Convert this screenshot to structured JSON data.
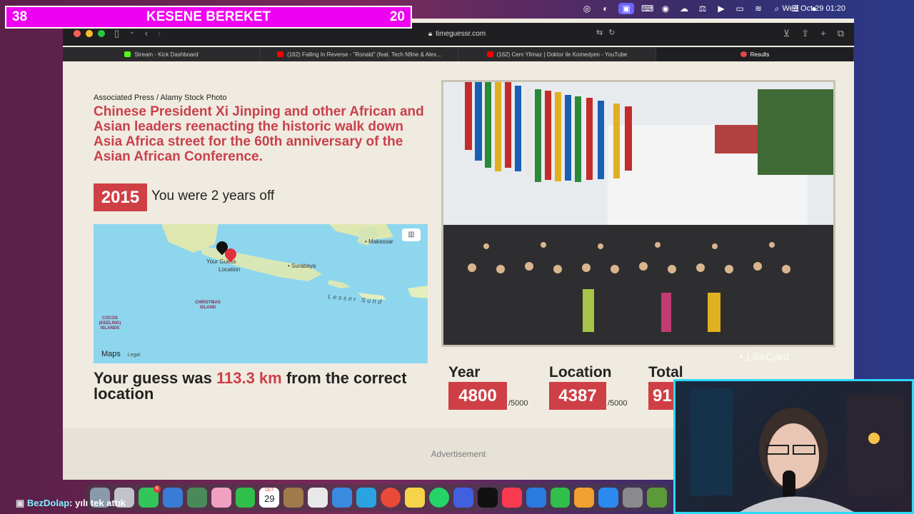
{
  "menubar": {
    "clock": "Wed Oct 29  01:20"
  },
  "overlay": {
    "left_number": "38",
    "title": "KESENE BEREKET",
    "right_number": "20"
  },
  "browser": {
    "url": "timeguessr.com",
    "tabs": [
      {
        "label": "Stream - Kick Dashboard",
        "icon_color": "#53fc18"
      },
      {
        "label": "(162) Falling In Reverse - \"Ronald\" (feat. Tech N9ne & Alex...",
        "icon_color": "#ff0000"
      },
      {
        "label": "(162) Cem Yilmaz | Doktor ile Komedyen - YouTube",
        "icon_color": "#ff0000"
      },
      {
        "label": "Results",
        "icon_color": "#e04848"
      }
    ]
  },
  "result": {
    "credit": "Associated Press / Alamy Stock Photo",
    "description": "Chinese President Xi Jinping and other African and Asian leaders reenacting the historic walk down Asia Africa street for the 60th anniversary of the Asian African Conference.",
    "year": "2015",
    "year_message": "You were 2 years off",
    "distance_prefix": "Your guess was ",
    "distance_value": "113.3 km",
    "distance_suffix": " from the correct location"
  },
  "map": {
    "labels": {
      "makassar": "Makassar",
      "surabaya": "Surabaya",
      "your_guess": "Your Guess",
      "location": "Location",
      "christmas": "CHRISTMAS ISLAND",
      "cocos": "COCOS (KEELING) ISLANDS",
      "lesser": "L e s s e r   S u n d",
      "maps": "Maps",
      "legal": "Legal"
    }
  },
  "scores": {
    "year_label": "Year",
    "year_value": "4800",
    "year_max": "/5000",
    "location_label": "Location",
    "location_value": "4387",
    "location_max": "/5000",
    "total_label": "Total",
    "total_value": "91"
  },
  "ad": {
    "label": "Advertisement"
  },
  "watermark": {
    "text": "LikeCard"
  },
  "chat": {
    "user": "BezDolap",
    "message": ": yılı tek attık"
  },
  "dock": {
    "calendar_month": "OCT",
    "calendar_day": "29",
    "messages_badge": "6"
  }
}
